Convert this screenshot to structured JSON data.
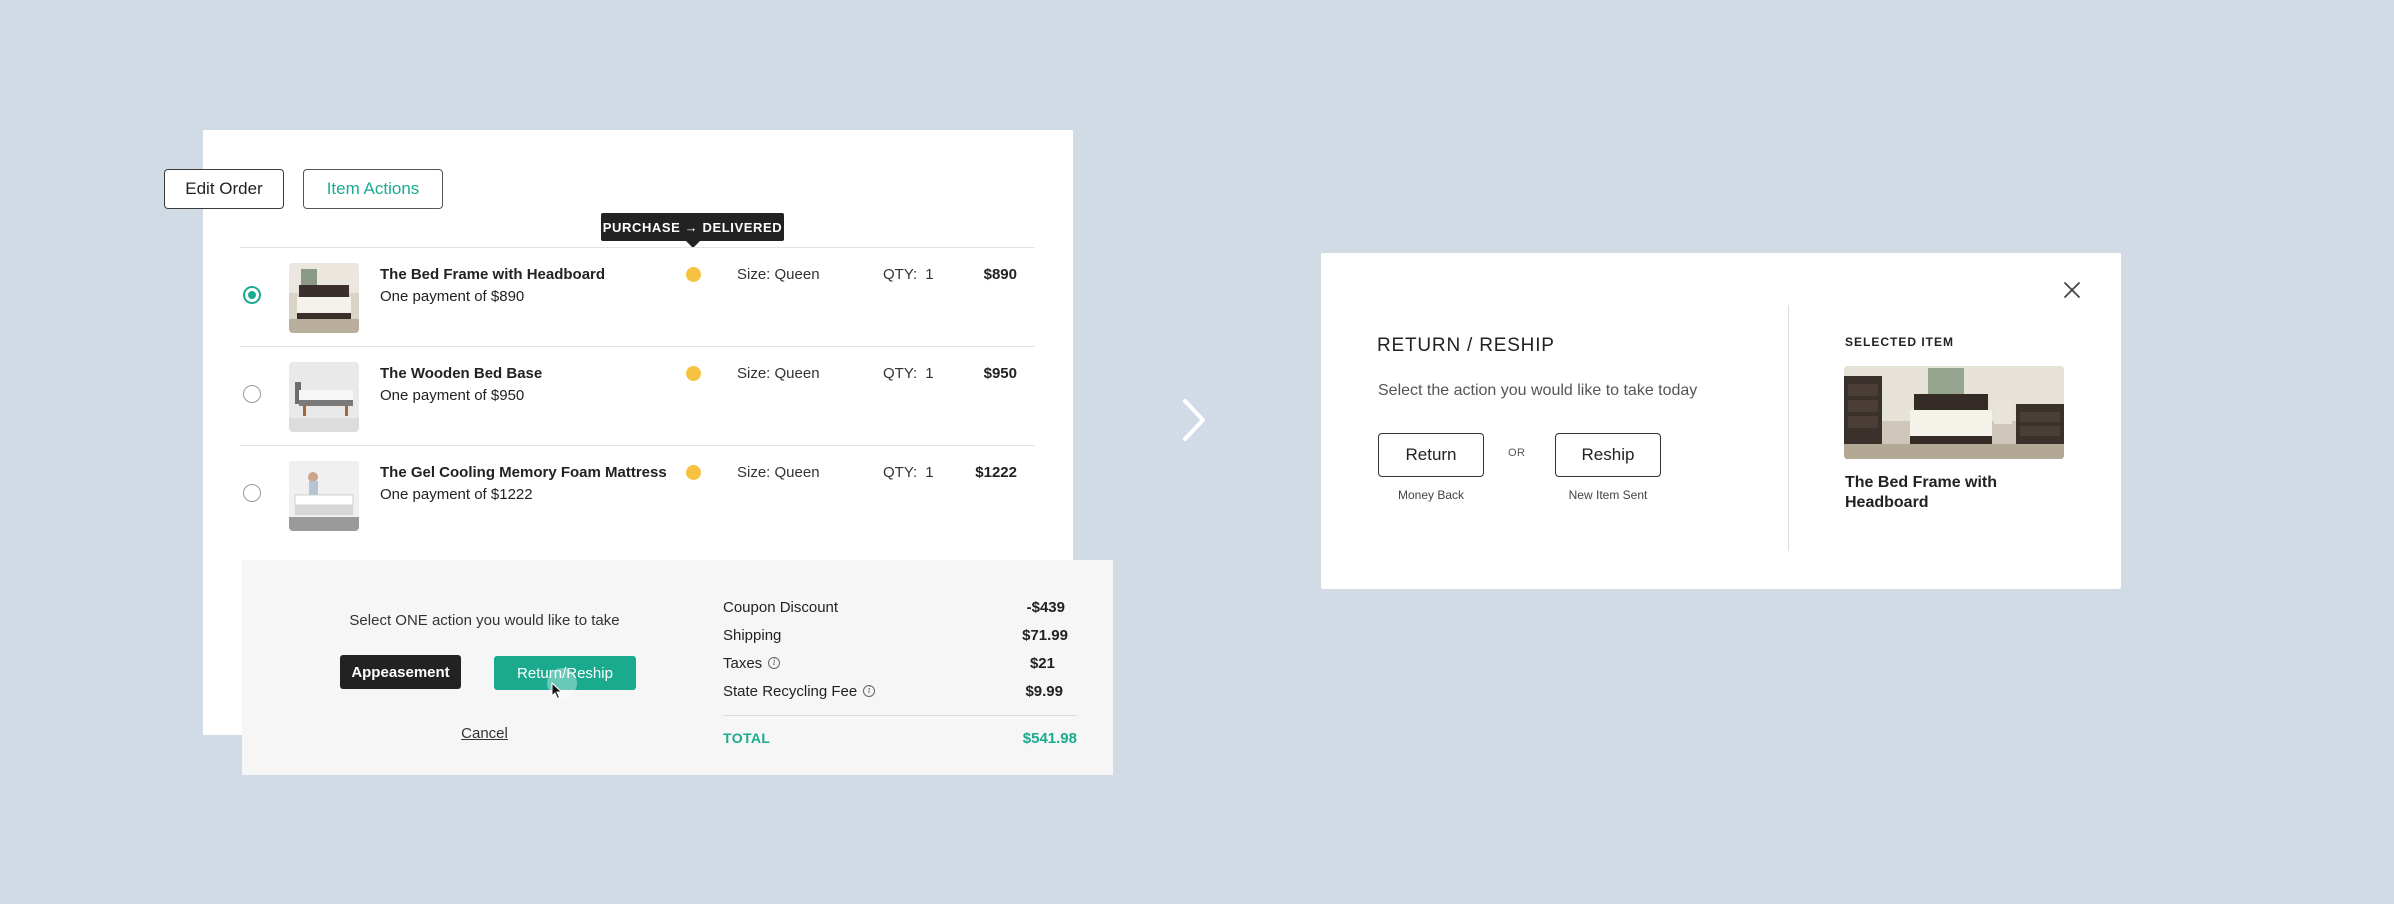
{
  "toolbar": {
    "edit_order_label": "Edit Order",
    "item_actions_label": "Item Actions"
  },
  "tooltip": {
    "text": "PURCHASE → DELIVERED"
  },
  "items": [
    {
      "name": "The Bed Frame with Headboard",
      "payment": "One payment of $890",
      "size": "Size: Queen",
      "qty_label": "QTY:",
      "qty": "1",
      "price": "$890",
      "selected": true,
      "status_color": "#f5c242"
    },
    {
      "name": "The Wooden Bed Base",
      "payment": "One payment of $950",
      "size": "Size: Queen",
      "qty_label": "QTY:",
      "qty": "1",
      "price": "$950",
      "selected": false,
      "status_color": "#f5c242"
    },
    {
      "name": "The Gel Cooling Memory Foam Mattress",
      "payment": "One payment of $1222",
      "size": "Size: Queen",
      "qty_label": "QTY:",
      "qty": "1",
      "price": "$1222",
      "selected": false,
      "status_color": "#f5c242"
    }
  ],
  "action_panel": {
    "prompt": "Select ONE action you would like to take",
    "appeasement_label": "Appeasement",
    "return_reship_label": "Return/Reship",
    "cancel_label": "Cancel"
  },
  "summary": {
    "rows": [
      {
        "label": "Coupon Discount",
        "value": "-$439",
        "info": false
      },
      {
        "label": "Shipping",
        "value": "$71.99",
        "info": false
      },
      {
        "label": "Taxes",
        "value": "$21",
        "info": true
      },
      {
        "label": "State Recycling Fee",
        "value": "$9.99",
        "info": true
      }
    ],
    "total_label": "TOTAL",
    "total_value": "$541.98"
  },
  "modal": {
    "title": "RETURN / RESHIP",
    "subtitle": "Select the action you would like to take today",
    "return_label": "Return",
    "return_caption": "Money Back",
    "or_label": "OR",
    "reship_label": "Reship",
    "reship_caption": "New Item Sent",
    "selected_label": "SELECTED ITEM",
    "selected_name": "The Bed Frame with Headboard"
  },
  "colors": {
    "accent": "#1aab8f",
    "background": "#d1dbe6",
    "status_pending": "#f5c242"
  },
  "icons": [
    "chevron-right-icon",
    "close-icon",
    "info-icon",
    "cursor-icon"
  ]
}
